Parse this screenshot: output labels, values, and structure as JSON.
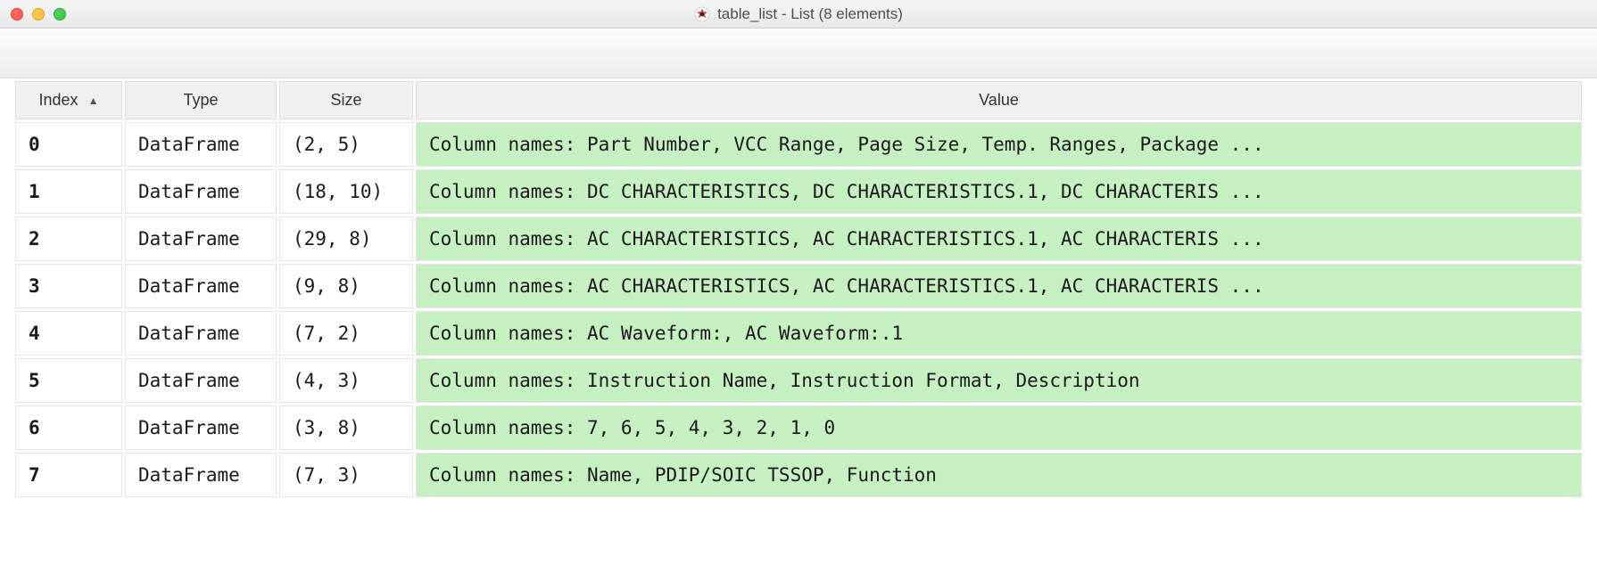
{
  "window": {
    "title": "table_list - List (8 elements)"
  },
  "columns": {
    "index": "Index",
    "type": "Type",
    "size": "Size",
    "value": "Value"
  },
  "sort_indicator": "▲",
  "rows": [
    {
      "index": "0",
      "type": "DataFrame",
      "size": "(2, 5)",
      "value": "Column names: Part Number, VCC Range, Page Size, Temp. Ranges, Package ..."
    },
    {
      "index": "1",
      "type": "DataFrame",
      "size": "(18, 10)",
      "value": "Column names: DC CHARACTERISTICS, DC CHARACTERISTICS.1, DC CHARACTERIS ..."
    },
    {
      "index": "2",
      "type": "DataFrame",
      "size": "(29, 8)",
      "value": "Column names: AC CHARACTERISTICS, AC CHARACTERISTICS.1, AC CHARACTERIS ..."
    },
    {
      "index": "3",
      "type": "DataFrame",
      "size": "(9, 8)",
      "value": "Column names: AC CHARACTERISTICS, AC CHARACTERISTICS.1, AC CHARACTERIS ..."
    },
    {
      "index": "4",
      "type": "DataFrame",
      "size": "(7, 2)",
      "value": "Column names: AC Waveform:, AC Waveform:.1"
    },
    {
      "index": "5",
      "type": "DataFrame",
      "size": "(4, 3)",
      "value": "Column names: Instruction Name, Instruction Format, Description"
    },
    {
      "index": "6",
      "type": "DataFrame",
      "size": "(3, 8)",
      "value": "Column names: 7, 6, 5, 4, 3, 2, 1, 0"
    },
    {
      "index": "7",
      "type": "DataFrame",
      "size": "(7, 3)",
      "value": "Column names: Name, PDIP/SOIC TSSOP, Function"
    }
  ]
}
